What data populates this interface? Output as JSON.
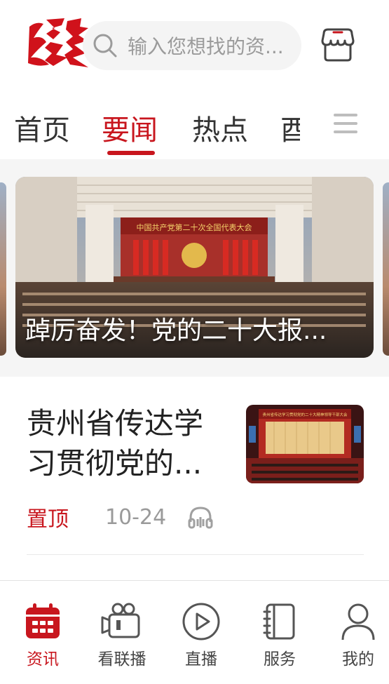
{
  "header": {
    "logo_text": "遵义",
    "search_placeholder": "输入您想找的资...",
    "search_icon": "search-icon",
    "shop_icon": "shop-icon"
  },
  "tabs": [
    {
      "label": "首页",
      "active": false
    },
    {
      "label": "要闻",
      "active": true
    },
    {
      "label": "热点",
      "active": false
    },
    {
      "label": "酉",
      "active": false
    }
  ],
  "tabs_menu_icon": "menu-icon",
  "banner": {
    "caption": "踔厉奋发！党的二十大报...",
    "slogan": "中国共产党第二十次全国代表大会"
  },
  "news": [
    {
      "title": "贵州省传达学习贯彻党的...",
      "badge": "置顶",
      "date": "10-24",
      "audio_icon": "headphones-icon",
      "thumb_slogan": "贵州省传达学习贯彻党的二十大精神领导干部大会"
    }
  ],
  "bottom_nav": [
    {
      "label": "资讯",
      "icon": "calendar-icon",
      "active": true
    },
    {
      "label": "看联播",
      "icon": "video-camera-icon",
      "active": false
    },
    {
      "label": "直播",
      "icon": "play-icon",
      "active": false
    },
    {
      "label": "服务",
      "icon": "notebook-icon",
      "active": false
    },
    {
      "label": "我的",
      "icon": "user-icon",
      "active": false
    }
  ],
  "colors": {
    "accent": "#c8161e",
    "text": "#333333",
    "muted": "#9a9a9a",
    "search_bg": "#f4f4f4"
  }
}
